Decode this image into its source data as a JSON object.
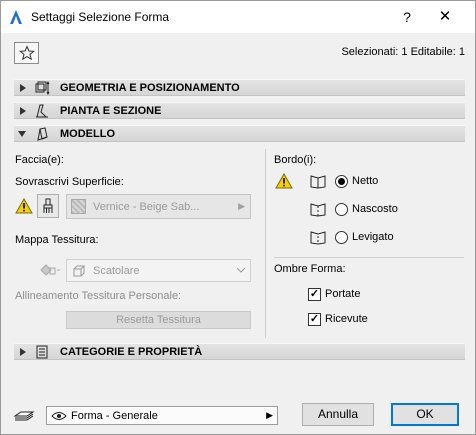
{
  "window": {
    "title": "Settaggi Selezione Forma",
    "help_label": "?",
    "close_label": "✕"
  },
  "header": {
    "selection_info": "Selezionati: 1 Editabile: 1"
  },
  "sections": [
    {
      "title": "GEOMETRIA E POSIZIONAMENTO",
      "expanded": false
    },
    {
      "title": "PIANTA E SEZIONE",
      "expanded": false
    },
    {
      "title": "MODELLO",
      "expanded": true
    },
    {
      "title": "CATEGORIE E PROPRIETÀ",
      "expanded": false
    }
  ],
  "model": {
    "faces_label": "Faccia(e):",
    "override_label": "Sovrascrivi Superficie:",
    "surface_value": "Vernice - Beige Sab...",
    "texture_map_label": "Mappa Tessitura:",
    "texture_value": "Scatolare",
    "custom_alignment_label": "Allineamento Tessitura Personale:",
    "reset_texture_label": "Resetta Tessitura",
    "edges_label": "Bordo(i):",
    "edge_options": [
      {
        "label": "Netto",
        "selected": true
      },
      {
        "label": "Nascosto",
        "selected": false
      },
      {
        "label": "Levigato",
        "selected": false
      }
    ],
    "shadows_label": "Ombre Forma:",
    "shadow_options": [
      {
        "label": "Portate",
        "checked": true
      },
      {
        "label": "Ricevute",
        "checked": true
      }
    ]
  },
  "footer": {
    "view_value": "Forma - Generale",
    "cancel_label": "Annulla",
    "ok_label": "OK"
  },
  "colors": {
    "accent": "#0078d7",
    "warning": "#f5d000"
  },
  "icons": [
    "star-icon",
    "geometry-icon",
    "floorplan-section-icon",
    "model-icon",
    "categories-icon",
    "warning-icon",
    "brush-icon",
    "edge-icon",
    "favorites-icon",
    "eye-icon"
  ]
}
